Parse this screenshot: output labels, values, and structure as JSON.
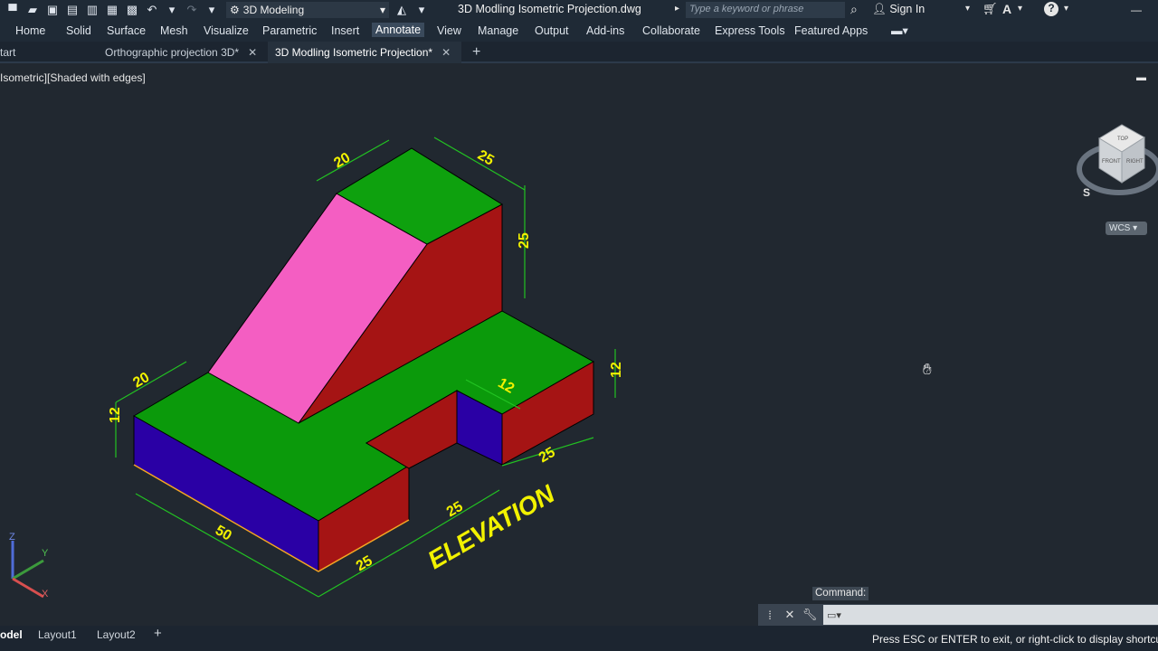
{
  "app": {
    "workspace": "3D Modeling",
    "document_title": "3D Modling Isometric Projection.dwg",
    "search_placeholder": "Type a keyword or phrase",
    "sign_in": "Sign In"
  },
  "menu": [
    "Home",
    "Solid",
    "Surface",
    "Mesh",
    "Visualize",
    "Parametric",
    "Insert",
    "Annotate",
    "View",
    "Manage",
    "Output",
    "Add-ins",
    "Collaborate",
    "Express Tools",
    "Featured Apps"
  ],
  "menu_active": "Annotate",
  "tabs": [
    {
      "label": "tart"
    },
    {
      "label": "Orthographic projection 3D*"
    },
    {
      "label": "3D Modling Isometric Projection*"
    }
  ],
  "viewport_label": "Isometric][Shaded with edges]",
  "dimensions": {
    "top_width": "20",
    "top_depth": "25",
    "top_height": "25",
    "left_depth": "20",
    "left_height": "12",
    "slot_width": "12",
    "right_height": "12",
    "front_length": "50",
    "front_short": "25",
    "bottom_mid": "25",
    "bottom_right": "25"
  },
  "elevation_label": "ELEVATION",
  "viewcube": {
    "top": "TOP",
    "front": "FRONT",
    "right": "RIGHT",
    "compass": "S"
  },
  "wcs": "WCS",
  "ucs": {
    "x": "X",
    "y": "Y",
    "z": "Z"
  },
  "command_label": "Command:",
  "layout_tabs": [
    "odel",
    "Layout1",
    "Layout2"
  ],
  "status_text": "Press ESC or ENTER to exit, or right-click to display shortcut-",
  "colors": {
    "green": "#0ea10e",
    "dark_green": "#0a8a0a",
    "red": "#a51414",
    "pink": "#f35ec0",
    "blue": "#2a00a5",
    "dimension": "#f2f200",
    "dim_line": "#22c322"
  }
}
